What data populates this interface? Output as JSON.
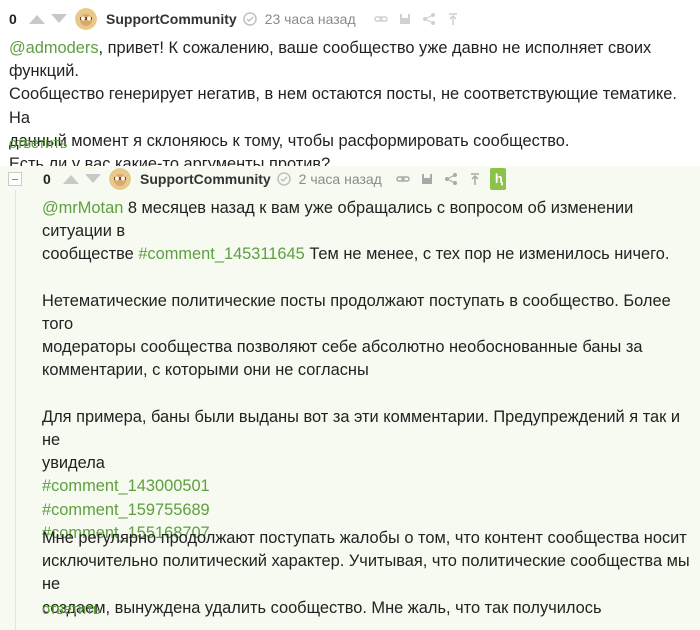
{
  "colors": {
    "accent": "#5e9f3f",
    "thread_bg": "#f6faf1",
    "muted": "#8a8a8a"
  },
  "comment1": {
    "rating": "0",
    "author": "SupportCommunity",
    "time": "23 часа назад",
    "mention": "@admoders",
    "lines": [
      ", привет! К сожалению, ваше сообщество уже давно не исполняет своих функций.",
      "Сообщество генерирует негатив, в нем остаются посты, не соответствующие тематике. На",
      "данный момент я склоняюсь к тому, чтобы расформировать сообщество.",
      "Есть ли у вас какие-то аргументы против?"
    ],
    "reply": "ответить"
  },
  "comment2": {
    "rating": "0",
    "author": "SupportCommunity",
    "time": "2 часа назад",
    "mention": "@mrMotan",
    "para1_line1": " 8 месяцев назад к вам уже обращались с вопросом об изменении ситуации в",
    "para1_line2a": "сообществе ",
    "para1_link": "#comment_145311645",
    "para1_line2b": " Тем не менее, с тех пор не изменилось ничего.",
    "para2": [
      "Нетематические политические посты продолжают поступать в сообщество. Более того",
      "модераторы сообщества позволяют себе абсолютно необоснованные баны за",
      "комментарии, с которыми они не согласны"
    ],
    "para3": [
      "Для примера, баны были выданы вот за эти комментарии. Предупреждений я так и не",
      "увидела"
    ],
    "links": [
      "#comment_143000501",
      "#comment_159755689",
      "#comment_155168707"
    ],
    "para4": [
      "Мне регулярно продолжают поступать жалобы о том, что контент сообщества носит",
      "исключительно политический характер. Учитывая, что политические сообщества мы не",
      "создаем, вынуждена удалить сообщество. Мне жаль, что так получилось"
    ],
    "reply": "ответить"
  },
  "icons": [
    "arrow-up-icon",
    "arrow-down-icon",
    "verified-icon",
    "link-icon",
    "save-icon",
    "share-icon",
    "arrow-top-icon"
  ]
}
